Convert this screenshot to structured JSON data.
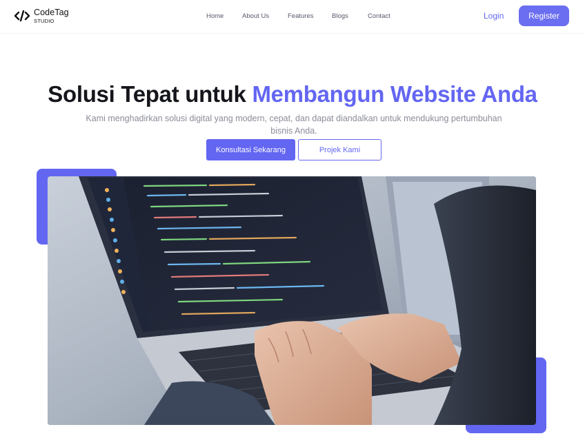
{
  "brand": {
    "name": "CodeTag",
    "sub": "STUDIO",
    "icon": "code-brackets-icon"
  },
  "nav": {
    "items": [
      "Home",
      "About Us",
      "Features",
      "Blogs",
      "Contact"
    ],
    "login": "Login",
    "register": "Register"
  },
  "hero": {
    "title_part1": "Solusi Tepat untuk ",
    "title_accent": "Membangun Website Anda",
    "subtitle": "Kami menghadirkan solusi digital yang modern, cepat, dan dapat diandalkan untuk mendukung pertumbuhan bisnis Anda.",
    "primary_button": "Konsultasi Sekarang",
    "secondary_button": "Projek Kami"
  },
  "colors": {
    "accent": "#6366f1",
    "text": "#15161c",
    "muted": "#8a8c99"
  }
}
